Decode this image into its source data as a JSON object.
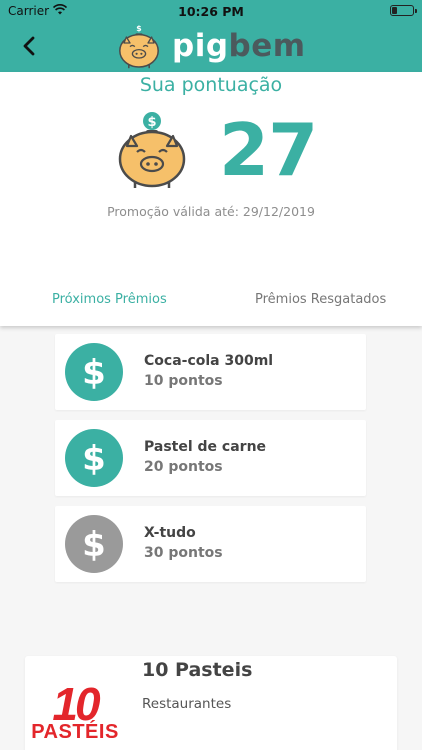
{
  "status_bar": {
    "carrier": "Carrier",
    "time": "10:26 PM"
  },
  "header": {
    "brand_part1": "pig",
    "brand_part2": "bem",
    "colors": {
      "accent": "#3bb0a3",
      "brand_dark": "#4b5a5d"
    },
    "icons": {
      "back": "chevron-left-icon",
      "logo": "piggy-bank-icon"
    }
  },
  "hero": {
    "title": "Sua pontuação",
    "score": "27",
    "promo_text": "Promoção válida até: 29/12/2019"
  },
  "tabs": [
    {
      "label": "Próximos Prêmios",
      "active": true
    },
    {
      "label": "Prêmios Resgatados",
      "active": false
    }
  ],
  "prizes": [
    {
      "name": "Coca-cola 300ml",
      "points": "10 pontos",
      "available": true,
      "icon": "dollar-coin-icon"
    },
    {
      "name": "Pastel de carne",
      "points": "20 pontos",
      "available": true,
      "icon": "dollar-coin-icon"
    },
    {
      "name": "X-tudo",
      "points": "30 pontos",
      "available": false,
      "icon": "dollar-coin-icon"
    }
  ],
  "coin_colors": {
    "available": "#3bb0a3",
    "unavailable": "#9a9a9a"
  },
  "store": {
    "name": "10 Pasteis",
    "category": "Restaurantes",
    "logo_number": "10",
    "logo_word": "PASTÉIS",
    "logo_color": "#e3262b"
  }
}
